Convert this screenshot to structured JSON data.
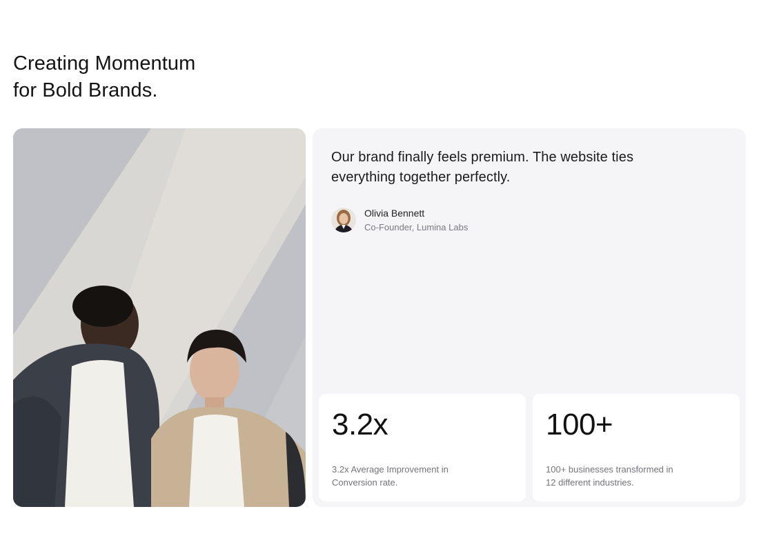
{
  "headline": {
    "line1": "Creating Momentum",
    "line2": "for Bold Brands."
  },
  "testimonial": {
    "quote": "Our brand finally feels premium. The website ties everything together perfectly.",
    "author_name": "Olivia Bennett",
    "author_role": "Co-Founder, Lumina Labs"
  },
  "stats": [
    {
      "value": "3.2x",
      "description": "3.2x Average Improvement in Conversion rate."
    },
    {
      "value": "100+",
      "description": "100+ businesses transformed in 12 different industries."
    }
  ],
  "colors": {
    "panel_bg": "#f5f4f7",
    "card_bg": "#ffffff",
    "text_primary": "#111111",
    "text_muted": "#74747a"
  }
}
